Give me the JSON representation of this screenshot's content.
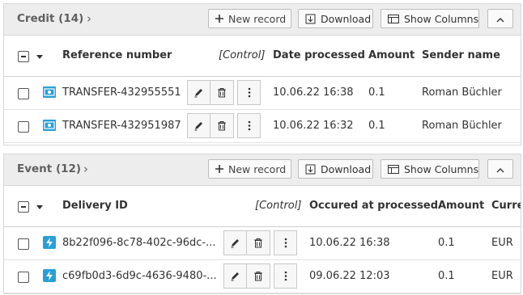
{
  "credit_panel": {
    "title": "Credit",
    "count": "(14)",
    "buttons": {
      "new_record": "New record",
      "download": "Download",
      "show_columns": "Show Columns"
    },
    "columns": [
      "Reference number",
      "[Control]",
      "Date processed",
      "Amount",
      "Sender name"
    ],
    "rows": [
      {
        "reference": "TRANSFER-432955551",
        "date": "10.06.22 16:38",
        "amount": "0.1",
        "sender": "Roman Büchler"
      },
      {
        "reference": "TRANSFER-432951987",
        "date": "10.06.22 16:32",
        "amount": "0.1",
        "sender": "Roman Büchler"
      }
    ]
  },
  "event_panel": {
    "title": "Event",
    "count": "(12)",
    "buttons": {
      "new_record": "New record",
      "download": "Download",
      "show_columns": "Show Columns"
    },
    "columns": [
      "Delivery ID",
      "[Control]",
      "Occured at processed",
      "Amount",
      "Curre"
    ],
    "rows": [
      {
        "delivery_id": "8b22f096-8c78-402c-96dc-...",
        "date": "10.06.22 16:38",
        "amount": "0.1",
        "currency": "EUR"
      },
      {
        "delivery_id": "c69fb0d3-6d9c-4636-9480-...",
        "date": "09.06.22 12:03",
        "amount": "0.1",
        "currency": "EUR"
      }
    ]
  },
  "icons": {
    "record_credit": "transfer-icon",
    "record_event": "lightning-icon",
    "accent": "#2a9fd6"
  }
}
